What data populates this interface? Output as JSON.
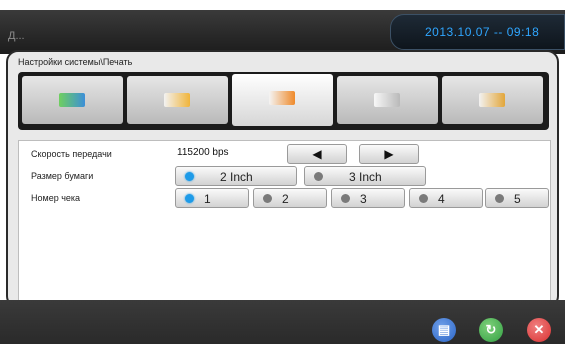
{
  "header": {
    "app_title": "Д...",
    "datetime": "2013.10.07 -- 09:18"
  },
  "panel": {
    "title": "Настройки системы\\Печать"
  },
  "tabs": [
    {
      "icon": "monitor-icon"
    },
    {
      "icon": "printer-settings-icon"
    },
    {
      "icon": "printer-icon"
    },
    {
      "icon": "printer-network-icon"
    },
    {
      "icon": "network-devices-icon"
    }
  ],
  "form": {
    "speed_label": "Скорость передачи",
    "speed_value": "115200 bps",
    "paper_label": "Размер бумаги",
    "paper_options": [
      "2 Inch",
      "3 Inch"
    ],
    "paper_selected": "2 Inch",
    "receipt_label": "Номер чека",
    "receipt_options": [
      "1",
      "2",
      "3",
      "4",
      "5"
    ],
    "receipt_selected": "1"
  },
  "colors": {
    "accent": "#1e9be8",
    "save": "#2b65c7",
    "refresh": "#33a043",
    "close": "#d93030"
  }
}
